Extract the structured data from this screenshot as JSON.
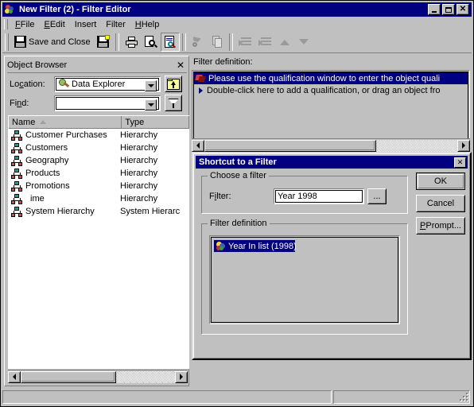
{
  "window": {
    "title": "New Filter (2) - Filter Editor",
    "icon": "filter-editor-icon",
    "minimize": "_",
    "maximize": "□",
    "close": "✕"
  },
  "menubar": {
    "items": [
      {
        "label": "File",
        "accel": "F"
      },
      {
        "label": "Edit",
        "accel": "E"
      },
      {
        "label": "Insert",
        "accel": "I"
      },
      {
        "label": "Filter",
        "accel": "t"
      },
      {
        "label": "Help",
        "accel": "H"
      }
    ]
  },
  "toolbar": {
    "save_and_close": "Save and Close",
    "buttons": [
      {
        "name": "save-and-close-button",
        "label": "Save and Close",
        "icon": "floppy-disk-icon",
        "enabled": true
      },
      {
        "name": "save-as-button",
        "label": "",
        "icon": "floppy-disk-new-icon",
        "enabled": true
      },
      {
        "name": "print-button",
        "label": "",
        "icon": "printer-icon",
        "enabled": true
      },
      {
        "name": "print-preview-button",
        "label": "",
        "icon": "print-preview-icon",
        "enabled": true
      },
      {
        "name": "object-browser-toggle-button",
        "label": "",
        "icon": "object-browser-icon",
        "enabled": true,
        "pressed": true
      },
      {
        "name": "cut-button",
        "label": "",
        "icon": "cut-icon",
        "enabled": false
      },
      {
        "name": "copy-button",
        "label": "",
        "icon": "copy-icon",
        "enabled": false
      },
      {
        "name": "outdent-button",
        "label": "",
        "icon": "outdent-icon",
        "enabled": false
      },
      {
        "name": "indent-button",
        "label": "",
        "icon": "indent-icon",
        "enabled": false
      },
      {
        "name": "move-up-button",
        "label": "",
        "icon": "arrow-up-icon",
        "enabled": false
      },
      {
        "name": "move-down-button",
        "label": "",
        "icon": "arrow-down-icon",
        "enabled": false
      }
    ]
  },
  "object_browser": {
    "caption": "Object Browser",
    "close_glyph": "✕",
    "location_label": "Location:",
    "location_accel": "c",
    "location_value": "Data Explorer",
    "location_icon": "data-explorer-icon",
    "up_button_icon": "up-one-level-icon",
    "find_label": "Find:",
    "find_accel": "n",
    "find_value": "",
    "filter_button_icon": "funnel-icon",
    "columns": [
      "Name",
      "Type"
    ],
    "sort_indicator": "ascending",
    "rows": [
      {
        "name": "Customer Purchases",
        "type": "Hierarchy"
      },
      {
        "name": "Customers",
        "type": "Hierarchy"
      },
      {
        "name": "Geography",
        "type": "Hierarchy"
      },
      {
        "name": "Products",
        "type": "Hierarchy"
      },
      {
        "name": "Promotions",
        "type": "Hierarchy"
      },
      {
        "name": "ime",
        "type": "Hierarchy"
      },
      {
        "name": "System Hierarchy",
        "type": "System Hierarc"
      }
    ],
    "hscroll": {
      "thumb_left_pct": 0,
      "thumb_width_pct": 62
    }
  },
  "filter_definition_panel": {
    "label": "Filter definition:",
    "rows": [
      {
        "text": "Please use the qualification window to enter the object quali",
        "selected": true,
        "icon": "filter-object-icon"
      },
      {
        "text": "Double-click here to add a qualification, or drag an object fro",
        "selected": false,
        "icon": "bullet-arrow-icon"
      }
    ],
    "hscroll": {
      "thumb_left_pct": 0,
      "thumb_width_pct": 68
    }
  },
  "dialog": {
    "title": "Shortcut to a Filter",
    "close_glyph": "✕",
    "choose_group_title": "Choose a filter",
    "filter_label": "Filter:",
    "filter_accel": "i",
    "filter_value": "Year 1998",
    "browse_button_label": "...",
    "definition_group_title": "Filter definition",
    "definition_items": [
      {
        "text": "Year In list (1998)",
        "selected": true,
        "icon": "filter-ball-icon"
      }
    ],
    "buttons": [
      {
        "name": "ok-button",
        "label": "OK",
        "default": true
      },
      {
        "name": "cancel-button",
        "label": "Cancel",
        "default": false
      },
      {
        "name": "prompt-button",
        "label": "Prompt...",
        "default": false,
        "accel": "P"
      }
    ]
  },
  "statusbar": {
    "left_text": "",
    "right_text": ""
  },
  "colors": {
    "face": "#c0c0c0",
    "titlebar": "#000080",
    "selection": "#000080",
    "window": "#ffffff",
    "shadow": "#808080"
  }
}
